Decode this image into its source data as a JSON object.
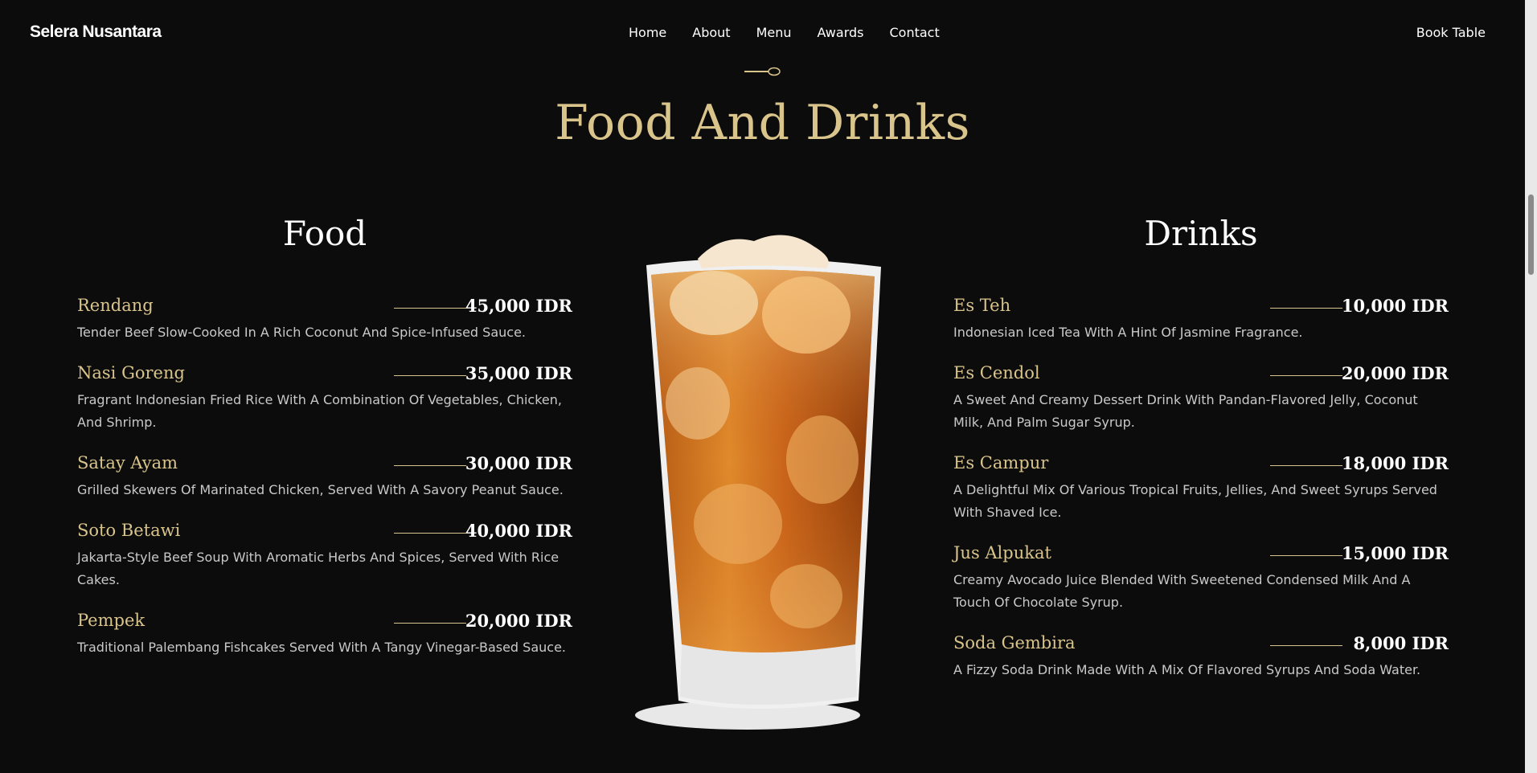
{
  "brand": "Selera Nusantara",
  "nav": [
    "Home",
    "About",
    "Menu",
    "Awards",
    "Contact"
  ],
  "cta": "Book Table",
  "section_title": "Food And Drinks",
  "food": {
    "title": "Food",
    "items": [
      {
        "name": "Rendang",
        "price": "45,000 IDR",
        "desc": "Tender Beef Slow-Cooked In A Rich Coconut And Spice-Infused Sauce."
      },
      {
        "name": "Nasi Goreng",
        "price": "35,000 IDR",
        "desc": "Fragrant Indonesian Fried Rice With A Combination Of Vegetables, Chicken, And Shrimp."
      },
      {
        "name": "Satay Ayam",
        "price": "30,000 IDR",
        "desc": "Grilled Skewers Of Marinated Chicken, Served With A Savory Peanut Sauce."
      },
      {
        "name": "Soto Betawi",
        "price": "40,000 IDR",
        "desc": "Jakarta-Style Beef Soup With Aromatic Herbs And Spices, Served With Rice Cakes."
      },
      {
        "name": "Pempek",
        "price": "20,000 IDR",
        "desc": "Traditional Palembang Fishcakes Served With A Tangy Vinegar-Based Sauce."
      }
    ]
  },
  "drinks": {
    "title": "Drinks",
    "items": [
      {
        "name": "Es Teh",
        "price": "10,000 IDR",
        "desc": "Indonesian Iced Tea With A Hint Of Jasmine Fragrance."
      },
      {
        "name": "Es Cendol",
        "price": "20,000 IDR",
        "desc": "A Sweet And Creamy Dessert Drink With Pandan-Flavored Jelly, Coconut Milk, And Palm Sugar Syrup."
      },
      {
        "name": "Es Campur",
        "price": "18,000 IDR",
        "desc": "A Delightful Mix Of Various Tropical Fruits, Jellies, And Sweet Syrups Served With Shaved Ice."
      },
      {
        "name": "Jus Alpukat",
        "price": "15,000 IDR",
        "desc": "Creamy Avocado Juice Blended With Sweetened Condensed Milk And A Touch Of Chocolate Syrup."
      },
      {
        "name": "Soda Gembira",
        "price": "8,000 IDR",
        "desc": "A Fizzy Soda Drink Made With A Mix Of Flavored Syrups And Soda Water."
      }
    ]
  },
  "colors": {
    "accent": "#d9c48b",
    "background": "#0c0c0c"
  },
  "icons": [
    "spoon-icon",
    "iced-tea-image"
  ]
}
